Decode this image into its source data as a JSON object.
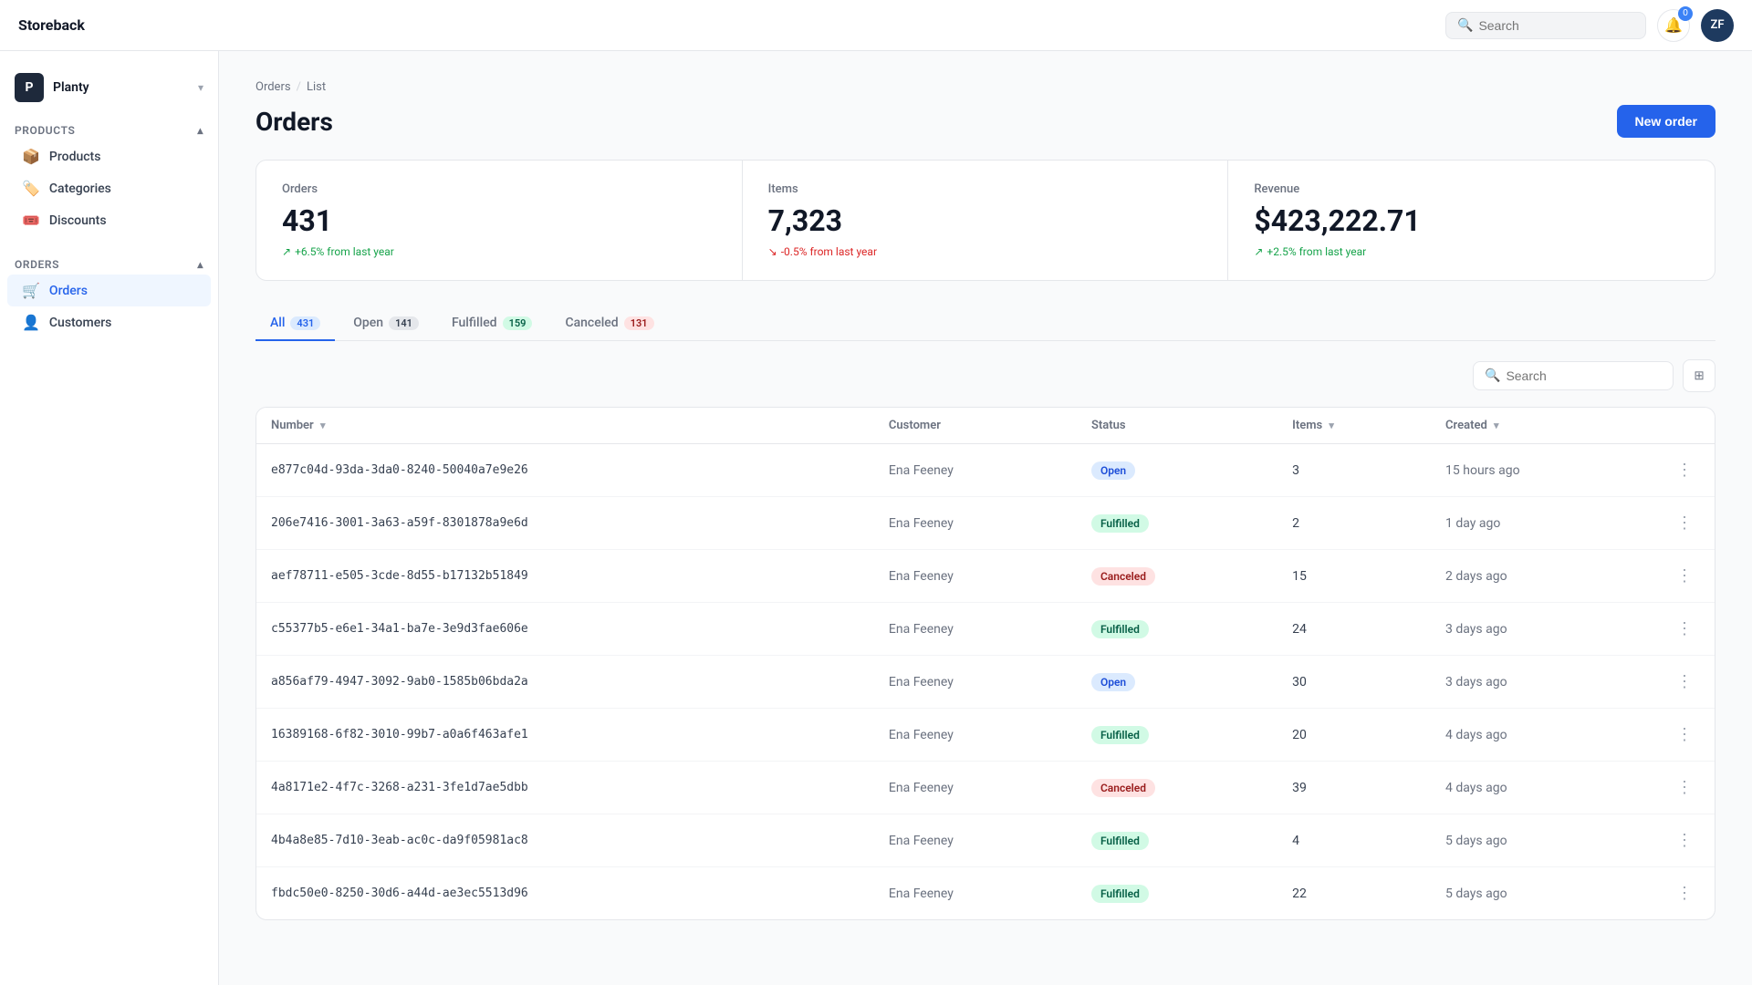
{
  "app": {
    "brand": "Storeback",
    "search_placeholder": "Search",
    "notif_count": "0",
    "avatar_initials": "ZF"
  },
  "sidebar": {
    "store_icon": "P",
    "store_name": "Planty",
    "products_section": "Products",
    "products_items": [
      {
        "id": "products",
        "label": "Products",
        "icon": "📦"
      },
      {
        "id": "categories",
        "label": "Categories",
        "icon": "🏷️"
      },
      {
        "id": "discounts",
        "label": "Discounts",
        "icon": "🎟️"
      }
    ],
    "orders_section": "Orders",
    "orders_items": [
      {
        "id": "orders",
        "label": "Orders",
        "icon": "🛒",
        "active": true
      },
      {
        "id": "customers",
        "label": "Customers",
        "icon": "👤"
      }
    ]
  },
  "breadcrumb": {
    "parent": "Orders",
    "current": "List"
  },
  "page": {
    "title": "Orders",
    "new_order_btn": "New order"
  },
  "stats": [
    {
      "label": "Orders",
      "value": "431",
      "change": "+6.5% from last year",
      "direction": "up"
    },
    {
      "label": "Items",
      "value": "7,323",
      "change": "-0.5% from last year",
      "direction": "down"
    },
    {
      "label": "Revenue",
      "value": "$423,222.71",
      "change": "+2.5% from last year",
      "direction": "up"
    }
  ],
  "tabs": [
    {
      "id": "all",
      "label": "All",
      "count": "431",
      "active": true,
      "badge_class": ""
    },
    {
      "id": "open",
      "label": "Open",
      "count": "141",
      "active": false,
      "badge_class": ""
    },
    {
      "id": "fulfilled",
      "label": "Fulfilled",
      "count": "159",
      "active": false,
      "badge_class": "green"
    },
    {
      "id": "canceled",
      "label": "Canceled",
      "count": "131",
      "active": false,
      "badge_class": "red"
    }
  ],
  "table": {
    "search_placeholder": "Search",
    "columns": [
      {
        "key": "number",
        "label": "Number",
        "sortable": true
      },
      {
        "key": "customer",
        "label": "Customer",
        "sortable": false
      },
      {
        "key": "status",
        "label": "Status",
        "sortable": false
      },
      {
        "key": "items",
        "label": "Items",
        "sortable": true
      },
      {
        "key": "created",
        "label": "Created",
        "sortable": true
      }
    ],
    "rows": [
      {
        "id": "e877c04d-93da-3da0-8240-50040a7e9e26",
        "customer": "Ena Feeney",
        "status": "Open",
        "status_class": "status-open",
        "items": "3",
        "created": "15 hours ago"
      },
      {
        "id": "206e7416-3001-3a63-a59f-8301878a9e6d",
        "customer": "Ena Feeney",
        "status": "Fulfilled",
        "status_class": "status-fulfilled",
        "items": "2",
        "created": "1 day ago"
      },
      {
        "id": "aef78711-e505-3cde-8d55-b17132b51849",
        "customer": "Ena Feeney",
        "status": "Canceled",
        "status_class": "status-canceled",
        "items": "15",
        "created": "2 days ago"
      },
      {
        "id": "c55377b5-e6e1-34a1-ba7e-3e9d3fae606e",
        "customer": "Ena Feeney",
        "status": "Fulfilled",
        "status_class": "status-fulfilled",
        "items": "24",
        "created": "3 days ago"
      },
      {
        "id": "a856af79-4947-3092-9ab0-1585b06bda2a",
        "customer": "Ena Feeney",
        "status": "Open",
        "status_class": "status-open",
        "items": "30",
        "created": "3 days ago"
      },
      {
        "id": "16389168-6f82-3010-99b7-a0a6f463afe1",
        "customer": "Ena Feeney",
        "status": "Fulfilled",
        "status_class": "status-fulfilled",
        "items": "20",
        "created": "4 days ago"
      },
      {
        "id": "4a8171e2-4f7c-3268-a231-3fe1d7ae5dbb",
        "customer": "Ena Feeney",
        "status": "Canceled",
        "status_class": "status-canceled",
        "items": "39",
        "created": "4 days ago"
      },
      {
        "id": "4b4a8e85-7d10-3eab-ac0c-da9f05981ac8",
        "customer": "Ena Feeney",
        "status": "Fulfilled",
        "status_class": "status-fulfilled",
        "items": "4",
        "created": "5 days ago"
      },
      {
        "id": "fbdc50e0-8250-30d6-a44d-ae3ec5513d96",
        "customer": "Ena Feeney",
        "status": "Fulfilled",
        "status_class": "status-fulfilled",
        "items": "22",
        "created": "5 days ago"
      }
    ]
  }
}
